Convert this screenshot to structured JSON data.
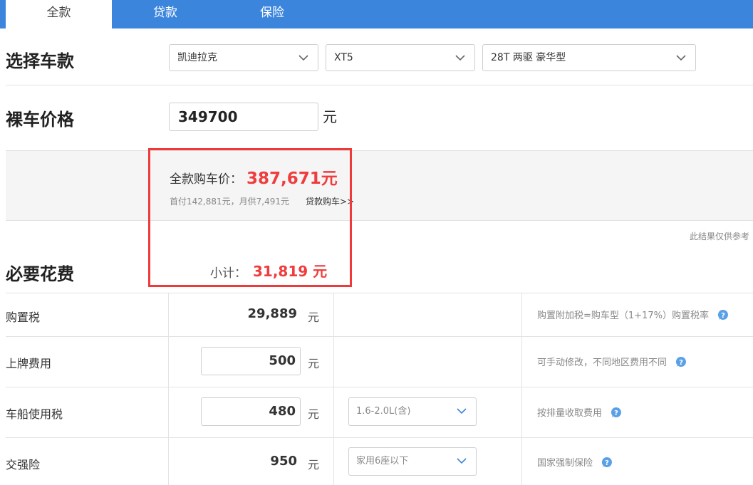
{
  "tabs": [
    {
      "label": "全款",
      "active": true
    },
    {
      "label": "贷款",
      "active": false
    },
    {
      "label": "保险",
      "active": false
    }
  ],
  "select_car": {
    "title": "选择车款",
    "brand": "凯迪拉克",
    "model": "XT5",
    "trim": "28T 两驱 豪华型"
  },
  "bare_price": {
    "title": "裸车价格",
    "value": "349700",
    "unit": "元"
  },
  "summary": {
    "full_label": "全款购车价：",
    "full_value": "387,671元",
    "sub_info": "首付142,881元，月供7,491元",
    "loan_link": "贷款购车>>"
  },
  "note": "此结果仅供参考",
  "required": {
    "title": "必要花费",
    "subtotal_label": "小计：",
    "subtotal_value": "31,819 元"
  },
  "rows": [
    {
      "label": "购置税",
      "value": "29,889",
      "unit": "元",
      "hint": "购置附加税=购车型（1+17%）购置税率"
    },
    {
      "label": "上牌费用",
      "value": "500",
      "unit": "元",
      "hint": "可手动修改，不同地区费用不同"
    },
    {
      "label": "车船使用税",
      "value": "480",
      "unit": "元",
      "select": "1.6-2.0L(含)",
      "hint": "按排量收取费用"
    },
    {
      "label": "交强险",
      "value": "950",
      "unit": "元",
      "select": "家用6座以下",
      "hint": "国家强制保险"
    }
  ],
  "colors": {
    "tab_blue": "#3b85dd",
    "price_red": "#f03c3c",
    "highlight_box": "#f03a3a",
    "help_icon": "#5aa0e6"
  }
}
